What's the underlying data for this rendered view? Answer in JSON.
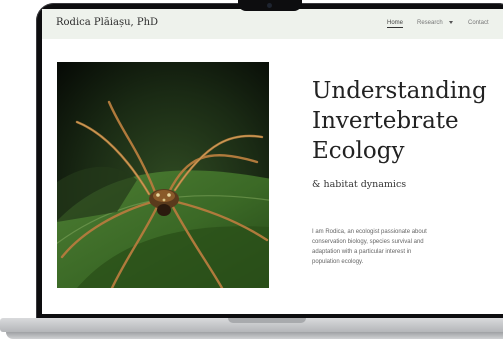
{
  "site": {
    "brand": "Rodica Plăiașu, PhD"
  },
  "nav": {
    "items": [
      {
        "label": "Home",
        "active": true
      },
      {
        "label": "Research",
        "has_dropdown": true,
        "dropdown_icon": "chevron-down-icon"
      },
      {
        "label": "Contact"
      }
    ]
  },
  "hero": {
    "image_alt": "harvestman spider on a green leaf",
    "title_lines": [
      "Understanding",
      "Invertebrate",
      "Ecology"
    ],
    "subtitle": "& habitat dynamics",
    "intro_lines": [
      "I am Rodica, an ecologist passionate about",
      "conservation biology, species survival and",
      "adaptation with a particular interest in",
      "population ecology."
    ]
  },
  "colors": {
    "navbar_bg": "#eef2ec",
    "text_dark": "#222222",
    "text_muted": "#666666",
    "leaf_green": "#3f6b2a"
  }
}
